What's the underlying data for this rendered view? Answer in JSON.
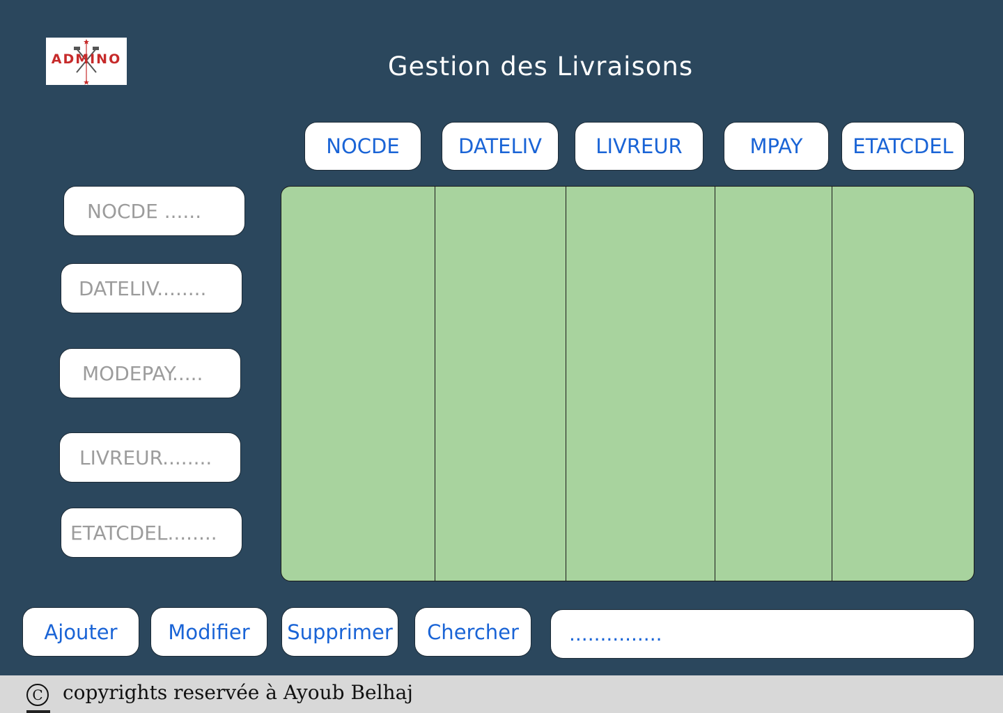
{
  "logo": {
    "text": "ADMINO",
    "colors": {
      "brand": "#c62a2a"
    }
  },
  "header": {
    "title": "Gestion des Livraisons"
  },
  "columns": [
    {
      "label": "NOCDE"
    },
    {
      "label": "DATELIV"
    },
    {
      "label": "LIVREUR"
    },
    {
      "label": "MPAY"
    },
    {
      "label": "ETATCDEL"
    }
  ],
  "form": {
    "nocde": {
      "placeholder": "NOCDE ......"
    },
    "dateliv": {
      "placeholder": "DATELIV........"
    },
    "modepay": {
      "placeholder": "MODEPAY....."
    },
    "livreur": {
      "placeholder": "LIVREUR........"
    },
    "etatcdel": {
      "placeholder": "ETATCDEL........"
    }
  },
  "grid": {
    "rows": []
  },
  "actions": {
    "ajouter": "Ajouter",
    "modifier": "Modifier",
    "supprimer": "Supprimer",
    "chercher": "Chercher",
    "result": "..............."
  },
  "footer": {
    "icon": "copyright-icon",
    "symbol": "C",
    "text": "copyrights reservée à Ayoub Belhaj"
  },
  "colors": {
    "background": "#2b475d",
    "grid": "#a8d39e",
    "accent_text": "#1a64d6",
    "placeholder": "#9c9c9c",
    "footer": "#d8d8d8"
  }
}
